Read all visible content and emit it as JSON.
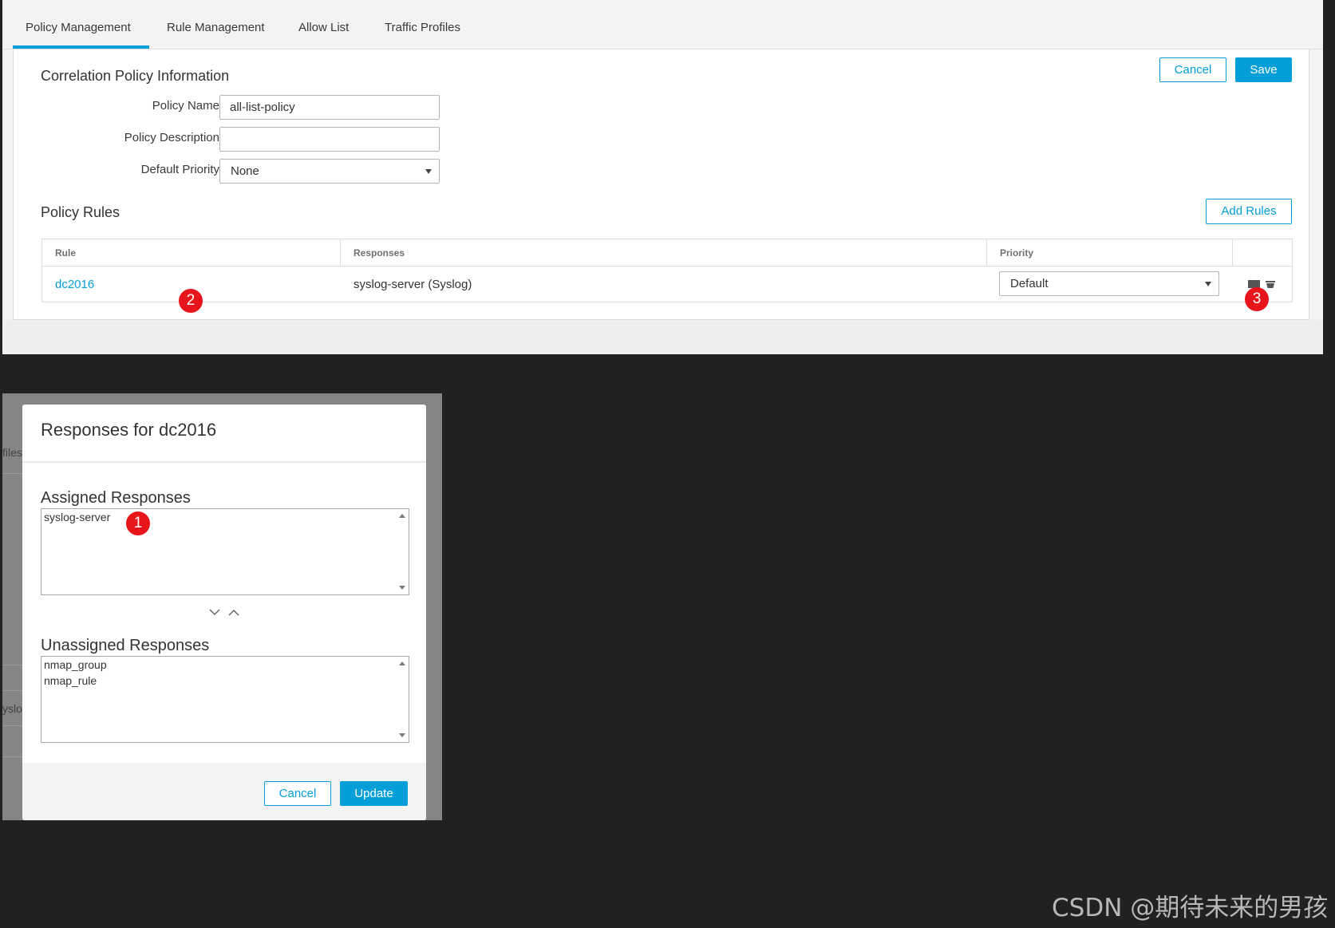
{
  "tabs": [
    {
      "label": "Policy Management",
      "active": true
    },
    {
      "label": "Rule Management",
      "active": false
    },
    {
      "label": "Allow List",
      "active": false
    },
    {
      "label": "Traffic Profiles",
      "active": false
    }
  ],
  "header_buttons": {
    "cancel": "Cancel",
    "save": "Save"
  },
  "policy_info": {
    "title": "Correlation Policy Information",
    "name_label": "Policy Name",
    "name_value": "all-list-policy",
    "description_label": "Policy Description",
    "description_value": "",
    "priority_label": "Default Priority",
    "priority_value": "None"
  },
  "policy_rules": {
    "title": "Policy Rules",
    "add_button": "Add Rules",
    "columns": [
      "Rule",
      "Responses",
      "Priority"
    ],
    "rows": [
      {
        "rule": "dc2016",
        "responses": "syslog-server (Syslog)",
        "priority": "Default"
      }
    ]
  },
  "badges": [
    "1",
    "2",
    "3"
  ],
  "background_fragments": {
    "tab": "files",
    "cell": "yslo"
  },
  "modal": {
    "title": "Responses for dc2016",
    "assigned_title": "Assigned Responses",
    "assigned": [
      "syslog-server"
    ],
    "unassigned_title": "Unassigned Responses",
    "unassigned": [
      "nmap_group",
      "nmap_rule"
    ],
    "cancel": "Cancel",
    "update": "Update"
  },
  "watermark": "CSDN @期待未来的男孩",
  "colors": {
    "accent": "#049fd9",
    "badge": "#e8141b"
  }
}
